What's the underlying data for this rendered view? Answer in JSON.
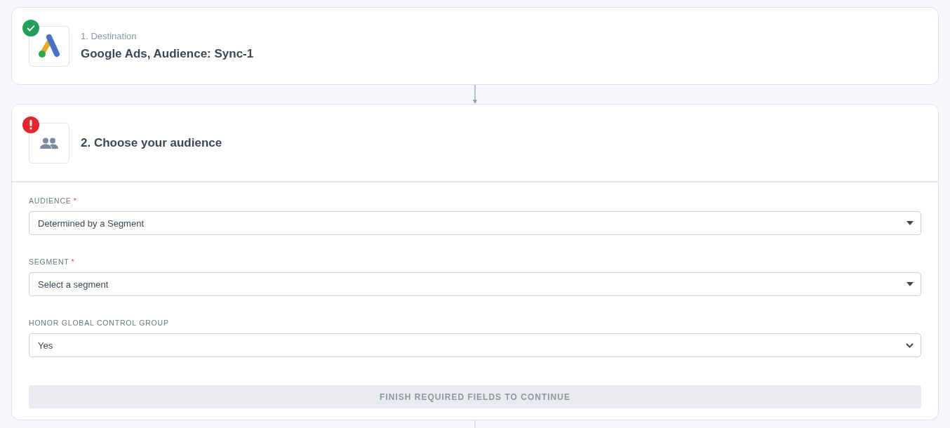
{
  "steps": [
    {
      "kind": "destination",
      "complete": true,
      "number_label": "1. Destination",
      "title": "Google Ads, Audience: Sync-1"
    },
    {
      "kind": "audience",
      "complete": false,
      "title": "2. Choose your audience",
      "fields": [
        {
          "label": "AUDIENCE",
          "required_mark": "*",
          "kind": "caret",
          "value": "Determined by a Segment"
        },
        {
          "label": "SEGMENT",
          "required_mark": "*",
          "kind": "caret",
          "value": "Select a segment"
        },
        {
          "label": "HONOR GLOBAL CONTROL GROUP",
          "kind": "chevron",
          "value": "Yes"
        }
      ],
      "button": {
        "label": "FINISH REQUIRED FIELDS TO CONTINUE",
        "disabled": true
      }
    }
  ]
}
